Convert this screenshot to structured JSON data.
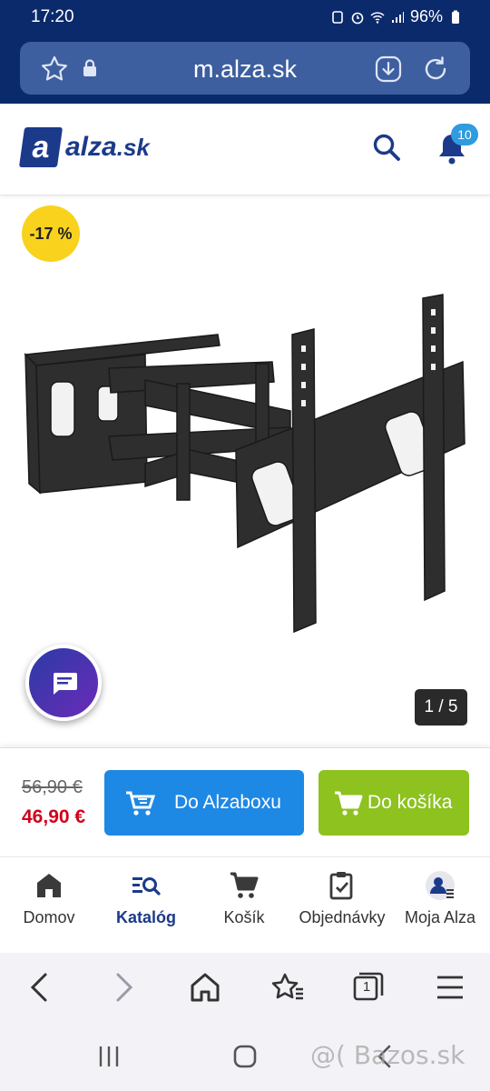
{
  "status_bar": {
    "time": "17:20",
    "battery": "96%"
  },
  "browser": {
    "url": "m.alza.sk"
  },
  "header": {
    "logo_letter": "a",
    "logo_name": "alza",
    "logo_tld": ".sk",
    "notifications_count": "10"
  },
  "product": {
    "discount": "-17 %",
    "image_counter": "1 / 5"
  },
  "buy": {
    "old_price": "56,90 €",
    "new_price": "46,90 €",
    "alzabox_label": "Do Alzaboxu",
    "cart_label": "Do košíka"
  },
  "site_nav": [
    {
      "label": "Domov",
      "icon": "home-icon"
    },
    {
      "label": "Katalóg",
      "icon": "catalog-search-icon",
      "active": true
    },
    {
      "label": "Košík",
      "icon": "cart-icon"
    },
    {
      "label": "Objednávky",
      "icon": "orders-clipboard-icon"
    },
    {
      "label": "Moja Alza",
      "icon": "account-icon"
    }
  ],
  "browser_toolbar": {
    "tabs_count": "1"
  },
  "watermark": "@( Bazos.sk",
  "colors": {
    "brand": "#1b3a8a",
    "status_bar": "#0b2a6b",
    "alzabox_button": "#1e88e5",
    "cart_button": "#8dc21f",
    "discount_badge": "#f8d21d",
    "sale_price": "#d0021b"
  }
}
